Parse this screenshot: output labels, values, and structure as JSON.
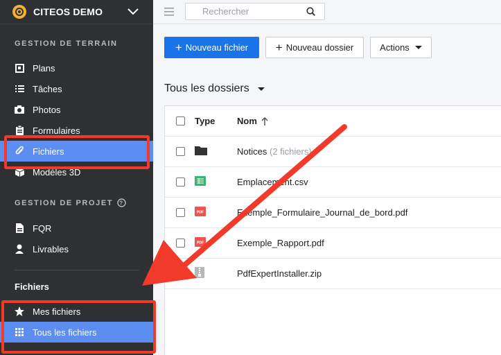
{
  "brand": {
    "title": "CITEOS DEMO"
  },
  "sidebar": {
    "section_terrain": "GESTION DE TERRAIN",
    "terrain_items": [
      {
        "label": "Plans",
        "icon": "plans-icon"
      },
      {
        "label": "Tâches",
        "icon": "list-icon"
      },
      {
        "label": "Photos",
        "icon": "camera-icon"
      },
      {
        "label": "Formulaires",
        "icon": "clipboard-icon"
      },
      {
        "label": "Fichiers",
        "icon": "paperclip-icon",
        "active": true
      },
      {
        "label": "Modèles 3D",
        "icon": "cube-icon"
      }
    ],
    "section_projet": "GESTION DE PROJET",
    "projet_items": [
      {
        "label": "FQR",
        "icon": "document-icon"
      },
      {
        "label": "Livrables",
        "icon": "person-icon"
      }
    ],
    "group_title": "Fichiers",
    "file_items": [
      {
        "label": "Mes fichiers",
        "icon": "star-icon"
      },
      {
        "label": "Tous les fichiers",
        "icon": "grid-icon",
        "active": true
      }
    ]
  },
  "search": {
    "placeholder": "Rechercher"
  },
  "toolbar": {
    "new_file": "Nouveau fichier",
    "new_folder": "Nouveau dossier",
    "actions": "Actions"
  },
  "folder_selector": "Tous les dossiers",
  "table": {
    "col_type": "Type",
    "col_name": "Nom",
    "rows": [
      {
        "name": "Notices",
        "count": "(2 fichiers)",
        "type": "folder"
      },
      {
        "name": "Emplacement.csv",
        "type": "csv"
      },
      {
        "name": "Exemple_Formulaire_Journal_de_bord.pdf",
        "type": "pdf"
      },
      {
        "name": "Exemple_Rapport.pdf",
        "type": "pdf"
      },
      {
        "name": "PdfExpertInstaller.zip",
        "type": "zip"
      }
    ]
  },
  "colors": {
    "accent": "#1a73e8",
    "sidebar_active": "#5b8ef0",
    "highlight": "#f23a2b",
    "sidebar_bg": "#2f3033"
  }
}
